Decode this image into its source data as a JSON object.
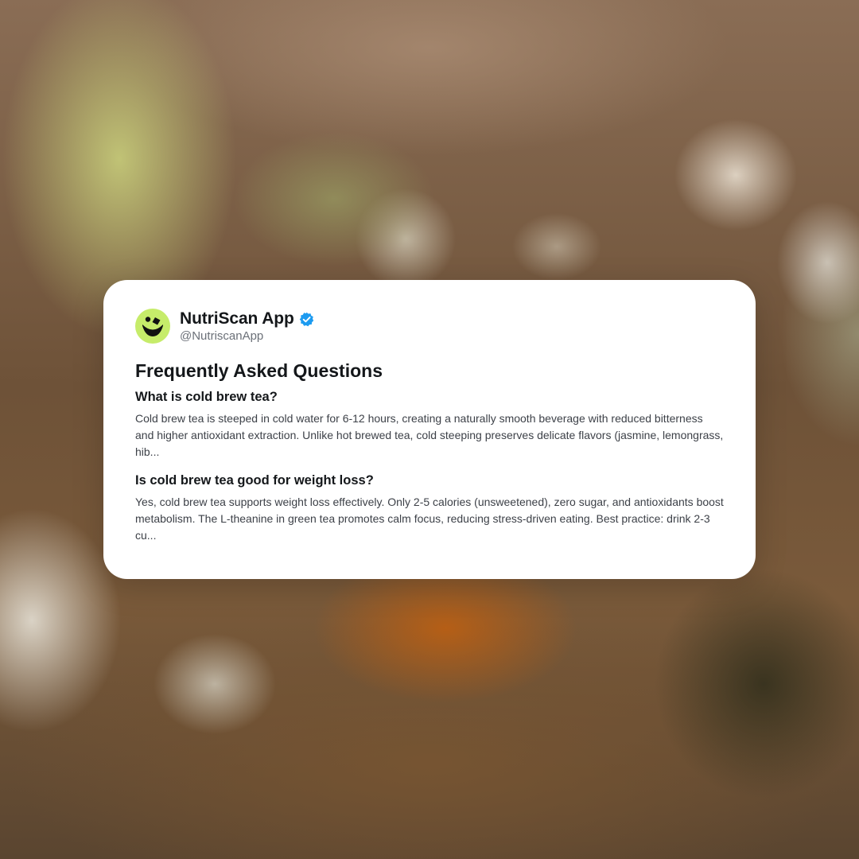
{
  "background": {
    "description_icon": "blurred-cold-brew-tea-photo"
  },
  "post": {
    "account": {
      "name": "NutriScan App",
      "handle": "@NutriscanApp",
      "verified": true,
      "avatar_icon": "nutriscan-logo-icon",
      "avatar_color": "#c6ec6a",
      "verified_color": "#1d9bf0"
    },
    "title": "Frequently Asked Questions",
    "faqs": [
      {
        "question": "What is cold brew tea?",
        "answer": "Cold brew tea is steeped in cold water for 6-12 hours, creating a naturally smooth beverage with reduced bitterness and higher antioxidant extraction. Unlike hot brewed tea, cold steeping preserves delicate flavors (jasmine, lemongrass, hib..."
      },
      {
        "question": "Is cold brew tea good for weight loss?",
        "answer": "Yes, cold brew tea supports weight loss effectively. Only 2-5 calories (unsweetened), zero sugar, and antioxidants boost metabolism. The L-theanine in green tea promotes calm focus, reducing stress-driven eating. Best practice: drink 2-3 cu..."
      }
    ]
  }
}
